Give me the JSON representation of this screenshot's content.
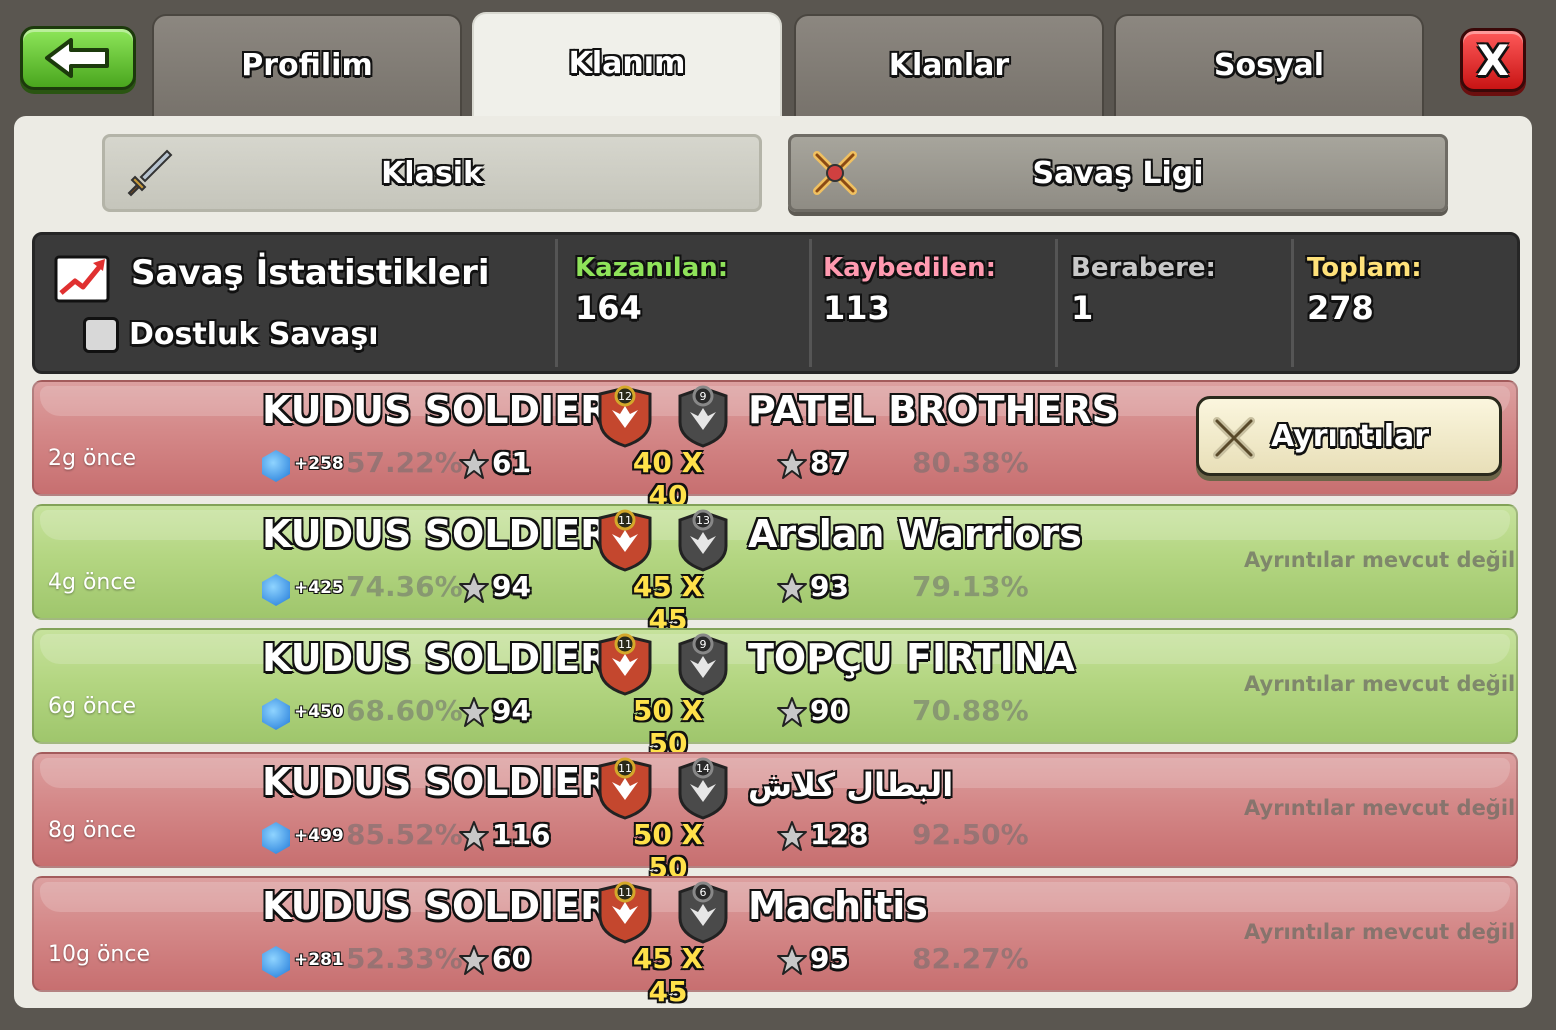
{
  "top_bar": {
    "tabs": [
      "Profilim",
      "Klanım",
      "Klanlar",
      "Sosyal"
    ],
    "active_tab": "Klanım",
    "close_label": "X"
  },
  "sub_tabs": {
    "classic": "Klasik",
    "league": "Savaş Ligi"
  },
  "stats": {
    "title": "Savaş İstatistikleri",
    "friendly_label": "Dostluk Savaşı",
    "friendly_checked": false,
    "won_label": "Kazanılan:",
    "won_value": "164",
    "lost_label": "Kaybedilen:",
    "lost_value": "113",
    "draw_label": "Berabere:",
    "draw_value": "1",
    "total_label": "Toplam:",
    "total_value": "278",
    "colors": {
      "won": "#8fe35a",
      "lost": "#ff9ab0",
      "draw": "#c8c8c8",
      "total": "#ffe27a"
    }
  },
  "wars": [
    {
      "ago": "2g önce",
      "result": "lose",
      "clan_name": "KUDUS SOLDIER",
      "clan_level": "12",
      "xp": "+258",
      "clan_pct": "57.22%",
      "clan_stars": "61",
      "size": "40 X 40",
      "opp_name": "PATEL BROTHERS",
      "opp_level": "9",
      "opp_stars": "87",
      "opp_pct": "80.38%",
      "details": "Ayrıntılar",
      "details_available": true
    },
    {
      "ago": "4g önce",
      "result": "win",
      "clan_name": "KUDUS SOLDIER",
      "clan_level": "11",
      "xp": "+425",
      "clan_pct": "74.36%",
      "clan_stars": "94",
      "size": "45 X 45",
      "opp_name": "Arslan Warriors",
      "opp_level": "13",
      "opp_stars": "93",
      "opp_pct": "79.13%",
      "details": "Ayrıntılar mevcut değil",
      "details_available": false
    },
    {
      "ago": "6g önce",
      "result": "win",
      "clan_name": "KUDUS SOLDIER",
      "clan_level": "11",
      "xp": "+450",
      "clan_pct": "68.60%",
      "clan_stars": "94",
      "size": "50 X 50",
      "opp_name": "TOPÇU FIRTINA",
      "opp_level": "9",
      "opp_stars": "90",
      "opp_pct": "70.88%",
      "details": "Ayrıntılar mevcut değil",
      "details_available": false
    },
    {
      "ago": "8g önce",
      "result": "lose",
      "clan_name": "KUDUS SOLDIER",
      "clan_level": "11",
      "xp": "+499",
      "clan_pct": "85.52%",
      "clan_stars": "116",
      "size": "50 X 50",
      "opp_name": "البطال كلاش",
      "opp_level": "14",
      "opp_stars": "128",
      "opp_pct": "92.50%",
      "details": "Ayrıntılar mevcut değil",
      "details_available": false
    },
    {
      "ago": "10g önce",
      "result": "lose",
      "clan_name": "KUDUS SOLDIER",
      "clan_level": "11",
      "xp": "+281",
      "clan_pct": "52.33%",
      "clan_stars": "60",
      "size": "45 X 45",
      "opp_name": "Machitis",
      "opp_level": "6",
      "opp_stars": "95",
      "opp_pct": "82.27%",
      "details": "Ayrıntılar mevcut değil",
      "details_available": false
    }
  ]
}
